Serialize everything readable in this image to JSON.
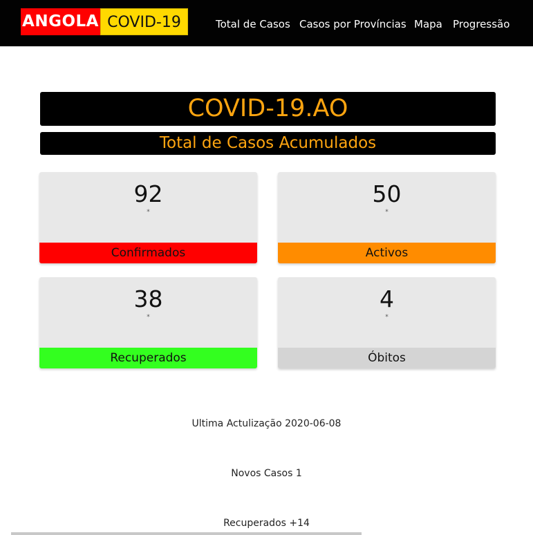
{
  "brand": {
    "part1": "ANGOLA",
    "part2": "COVID-19"
  },
  "nav": {
    "items": [
      "Total de Casos",
      "Casos por Províncias",
      "Mapa",
      "Progressão"
    ]
  },
  "header": {
    "title": "COVID-19.AO",
    "subtitle": "Total de Casos Acumulados"
  },
  "stats": [
    {
      "value": "92",
      "note": "*",
      "label": "Confirmados",
      "color": "#ff0000"
    },
    {
      "value": "50",
      "note": "*",
      "label": "Activos",
      "color": "#ff8c00"
    },
    {
      "value": "38",
      "note": "*",
      "label": "Recuperados",
      "color": "#33ff1f"
    },
    {
      "value": "4",
      "note": "*",
      "label": "Óbitos",
      "color": "#d4d4d4"
    }
  ],
  "updates": {
    "last_update": "Ultima Actulização 2020-06-08",
    "new_cases": "Novos Casos 1",
    "recovered": "Recuperados +14"
  }
}
